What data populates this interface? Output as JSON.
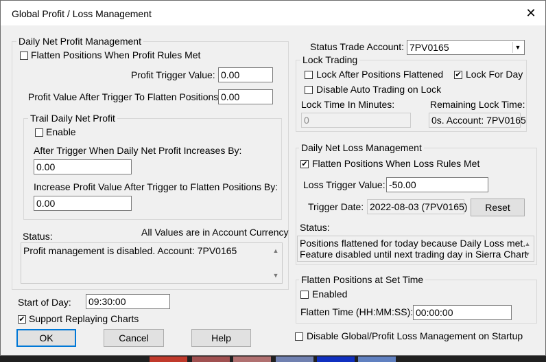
{
  "title": "Global Profit / Loss Management",
  "close_glyph": "✕",
  "profit": {
    "group_title": "Daily Net Profit Management",
    "flatten_label": "Flatten Positions When Profit Rules Met",
    "trigger_label": "Profit Trigger Value:",
    "trigger_value": "0.00",
    "after_label": "Profit Value After Trigger To Flatten Positions:",
    "after_value": "0.00",
    "trail": {
      "group_title": "Trail Daily Net Profit",
      "enable_label": "Enable",
      "increase_label": "After Trigger When Daily Net Profit Increases By:",
      "increase_value": "0.00",
      "increase_after_label": "Increase Profit Value After Trigger to Flatten Positions By:",
      "increase_after_value": "0.00"
    },
    "status_label": "Status:",
    "currency_note": "All Values are in Account Currency",
    "status_text": "Profit management is disabled. Account: 7PV0165"
  },
  "start_of_day_label": "Start of Day:",
  "start_of_day_value": "09:30:00",
  "replay_label": "Support Replaying Charts",
  "buttons": {
    "ok": "OK",
    "cancel": "Cancel",
    "help": "Help"
  },
  "status_trade_account_label": "Status Trade Account:",
  "status_trade_account_value": "7PV0165",
  "lock": {
    "group_title": "Lock Trading",
    "lock_after_label": "Lock After Positions Flattened",
    "lock_day_label": "Lock For Day",
    "disable_auto_label": "Disable Auto Trading on Lock",
    "time_label": "Lock Time In Minutes:",
    "time_value": "0",
    "remaining_label": "Remaining Lock Time:",
    "remaining_value": "0s. Account: 7PV0165"
  },
  "loss": {
    "group_title": "Daily Net Loss Management",
    "flatten_label": "Flatten Positions When Loss Rules Met",
    "trigger_label": "Loss Trigger Value:",
    "trigger_value": "-50.00",
    "date_label": "Trigger Date:",
    "date_value": "2022-08-03 (7PV0165)",
    "reset": "Reset",
    "status_label": "Status:",
    "status_line1": "Positions flattened for today because Daily Loss met.",
    "status_line2": "Feature disabled until next trading day in Sierra Chart"
  },
  "flatten_time": {
    "group_title": "Flatten Positions at Set Time",
    "enabled_label": "Enabled",
    "time_label": "Flatten Time (HH:MM:SS):",
    "time_value": "00:00:00"
  },
  "disable_startup_label": "Disable Global/Profit Loss Management on Startup",
  "checkmark": "✔",
  "arrows": {
    "up": "▲",
    "down": "▼"
  }
}
